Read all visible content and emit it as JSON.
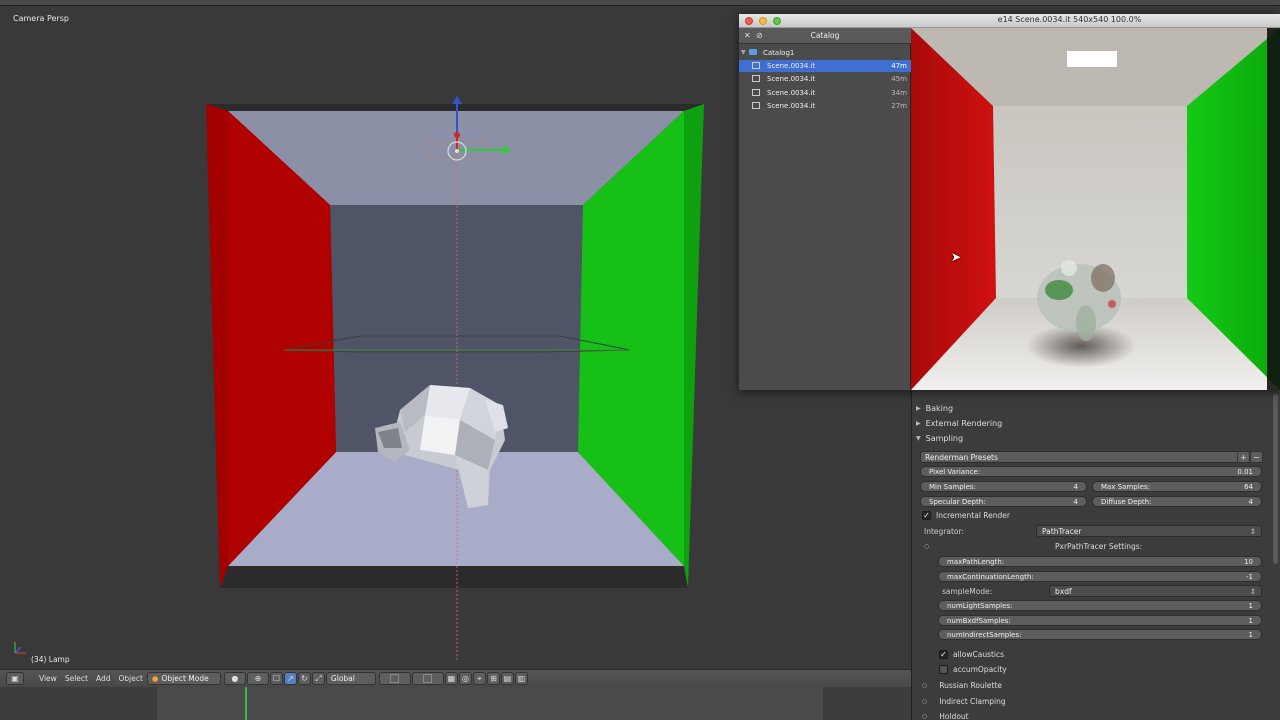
{
  "viewport": {
    "view_name": "Camera Persp",
    "object_label": "(34) Lamp"
  },
  "header": {
    "menu": [
      "View",
      "Select",
      "Add",
      "Object"
    ],
    "mode": "Object Mode",
    "orientation": "Global"
  },
  "it_window": {
    "title": "e14 Scene.0034.it 540x540 100.0%",
    "catalog_title": "Catalog",
    "catalog_root": "Catalog1",
    "items": [
      {
        "name": "Scene.0034.it",
        "age": "47m",
        "selected": true
      },
      {
        "name": "Scene.0034.it",
        "age": "45m",
        "selected": false
      },
      {
        "name": "Scene.0034.it",
        "age": "34m",
        "selected": false
      },
      {
        "name": "Scene.0034.it",
        "age": "27m",
        "selected": false
      }
    ]
  },
  "properties": {
    "panels_collapsed": [
      "Baking",
      "External Rendering"
    ],
    "sampling_label": "Sampling",
    "presets_label": "Renderman Presets",
    "pixel_variance": {
      "label": "Pixel Variance:",
      "value": "0.01"
    },
    "min_samples": {
      "label": "Min Samples:",
      "value": "4"
    },
    "max_samples": {
      "label": "Max Samples:",
      "value": "64"
    },
    "specular_depth": {
      "label": "Specular Depth:",
      "value": "4"
    },
    "diffuse_depth": {
      "label": "Diffuse Depth:",
      "value": "4"
    },
    "incremental_render": "Incremental Render",
    "integrator_label": "Integrator:",
    "integrator_value": "PathTracer",
    "pxr_settings": "PxrPathTracer Settings:",
    "max_path_length": {
      "label": "maxPathLength:",
      "value": "10"
    },
    "max_continuation_length": {
      "label": "maxContinuationLength:",
      "value": "-1"
    },
    "sample_mode_label": "sampleMode:",
    "sample_mode_value": "bxdf",
    "num_light_samples": {
      "label": "numLightSamples:",
      "value": "1"
    },
    "num_bxdf_samples": {
      "label": "numBxdfSamples:",
      "value": "1"
    },
    "num_indirect_samples": {
      "label": "numIndirectSamples:",
      "value": "1"
    },
    "allow_caustics": "allowCaustics",
    "accum_opacity": "accumOpacity",
    "russian_roulette": "Russian Roulette",
    "indirect_clamping": "Indirect Clamping",
    "holdout": "Holdout"
  },
  "colors": {
    "red_wall": "#a30000",
    "green_wall": "#16c016",
    "selection_blue": "#3f6fd1",
    "timeline_cursor": "#3fb849"
  }
}
